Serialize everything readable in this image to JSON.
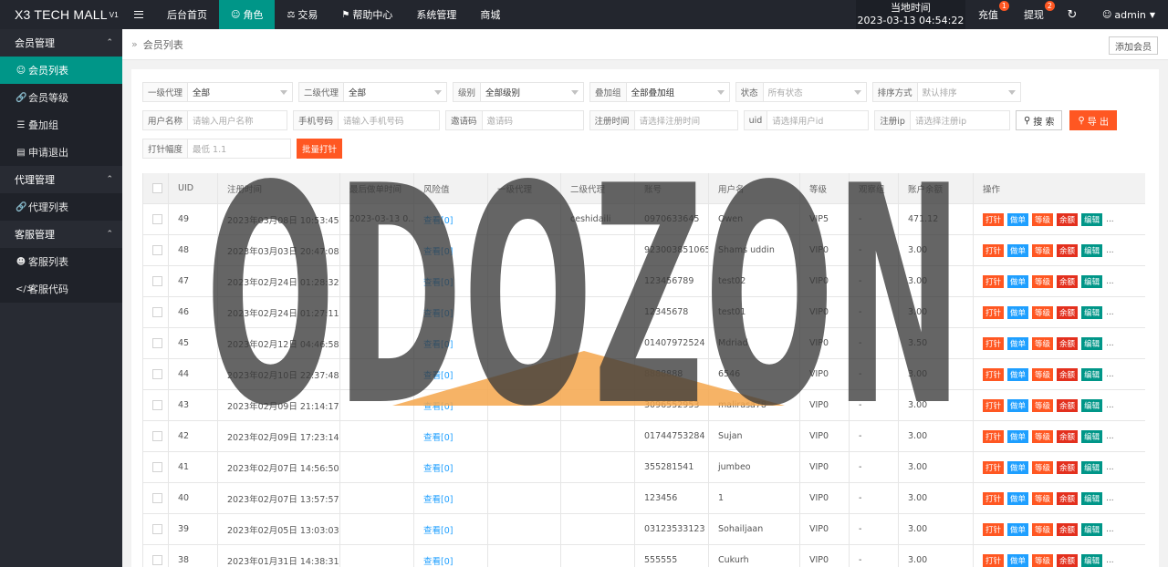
{
  "brand": {
    "name": "X3 TECH MALL",
    "version": "V1"
  },
  "topnav": {
    "items": [
      {
        "label": "后台首页",
        "icon": "",
        "active": false
      },
      {
        "label": "角色",
        "icon": "user-icon",
        "active": true
      },
      {
        "label": "交易",
        "icon": "scale-icon",
        "active": false
      },
      {
        "label": "帮助中心",
        "icon": "flag-icon",
        "active": false
      },
      {
        "label": "系统管理",
        "icon": "",
        "active": false
      },
      {
        "label": "商城",
        "icon": "",
        "active": false
      }
    ],
    "time_label": "当地时间",
    "time_value": "2023-03-13 04:54:22",
    "recharge": "充值",
    "recharge_badge": "1",
    "withdraw": "提现",
    "withdraw_badge": "2",
    "user": "admin"
  },
  "sidebar": {
    "groups": [
      {
        "label": "会员管理",
        "items": [
          {
            "label": "会员列表",
            "icon": "user-icon",
            "active": true
          },
          {
            "label": "会员等级",
            "icon": "link-icon",
            "active": false
          },
          {
            "label": "叠加组",
            "icon": "list-icon",
            "active": false
          },
          {
            "label": "申请退出",
            "icon": "doc-icon",
            "active": false
          }
        ]
      },
      {
        "label": "代理管理",
        "items": [
          {
            "label": "代理列表",
            "icon": "link-icon",
            "active": false
          }
        ]
      },
      {
        "label": "客服管理",
        "items": [
          {
            "label": "客服列表",
            "icon": "users-icon",
            "active": false
          },
          {
            "label": "客服代码",
            "icon": "code-icon",
            "active": false
          }
        ]
      }
    ]
  },
  "page": {
    "breadcrumb": "会员列表",
    "add_button": "添加会员"
  },
  "filters": {
    "agent1": {
      "label": "一级代理",
      "value": "全部"
    },
    "agent2": {
      "label": "二级代理",
      "value": "全部"
    },
    "level": {
      "label": "级别",
      "value": "全部级别"
    },
    "group": {
      "label": "叠加组",
      "value": "全部叠加组"
    },
    "status": {
      "label": "状态",
      "placeholder": "所有状态"
    },
    "sort": {
      "label": "排序方式",
      "placeholder": "默认排序"
    },
    "username": {
      "label": "用户名称",
      "placeholder": "请输入用户名称"
    },
    "phone": {
      "label": "手机号码",
      "placeholder": "请输入手机号码"
    },
    "invite": {
      "label": "邀请码",
      "placeholder": "邀请码"
    },
    "regtime": {
      "label": "注册时间",
      "placeholder": "请选择注册时间"
    },
    "uid": {
      "label": "uid",
      "placeholder": "请选择用户id"
    },
    "regip": {
      "label": "注册ip",
      "placeholder": "请选择注册ip"
    },
    "search_button": "搜 索",
    "export_button": "导 出",
    "range": {
      "label": "打针幅度",
      "placeholder": "最低 1.1"
    },
    "batch_button": "批量打针"
  },
  "table": {
    "headers": [
      "UID",
      "注册时间",
      "最后做单时间",
      "风险值",
      "一级代理",
      "二级代理",
      "账号",
      "用户名",
      "等级",
      "观察组",
      "账户余额",
      "操作"
    ],
    "actions": [
      "打针",
      "做单",
      "等级",
      "余额",
      "编辑"
    ],
    "more": "...",
    "rows": [
      {
        "uid": "49",
        "reg": "2023年03月08日 10:53:45",
        "last": "2023-03-13 0...",
        "risk": "查看[0]",
        "a1": "",
        "a2": "ceshidaili",
        "acct": "0970633645",
        "name": "Owen",
        "lvl": "VIP5",
        "grp": "-",
        "bal": "471.12"
      },
      {
        "uid": "48",
        "reg": "2023年03月03日 20:47:08",
        "last": "",
        "risk": "查看[0]",
        "a1": "",
        "a2": "",
        "acct": "923003851065",
        "name": "Shams uddin",
        "lvl": "VIP0",
        "grp": "-",
        "bal": "3.00"
      },
      {
        "uid": "47",
        "reg": "2023年02月24日 01:28:32",
        "last": "",
        "risk": "查看[0]",
        "a1": "",
        "a2": "",
        "acct": "123456789",
        "name": "test02",
        "lvl": "VIP0",
        "grp": "-",
        "bal": "3.00"
      },
      {
        "uid": "46",
        "reg": "2023年02月24日 01:27:11",
        "last": "",
        "risk": "查看[0]",
        "a1": "",
        "a2": "",
        "acct": "12345678",
        "name": "test01",
        "lvl": "VIP0",
        "grp": "-",
        "bal": "3.00"
      },
      {
        "uid": "45",
        "reg": "2023年02月12日 04:46:58",
        "last": "",
        "risk": "查看[0]",
        "a1": "",
        "a2": "",
        "acct": "01407972524",
        "name": "Mdriad",
        "lvl": "VIP0",
        "grp": "-",
        "bal": "3.50"
      },
      {
        "uid": "44",
        "reg": "2023年02月10日 22:37:48",
        "last": "",
        "risk": "查看[0]",
        "a1": "",
        "a2": "",
        "acct": "8888888",
        "name": "6546",
        "lvl": "VIP0",
        "grp": "-",
        "bal": "3.00"
      },
      {
        "uid": "43",
        "reg": "2023年02月09日 21:14:17",
        "last": "",
        "risk": "查看[0]",
        "a1": "",
        "a2": "",
        "acct": "3096552953",
        "name": "malirasa78",
        "lvl": "VIP0",
        "grp": "-",
        "bal": "3.00"
      },
      {
        "uid": "42",
        "reg": "2023年02月09日 17:23:14",
        "last": "",
        "risk": "查看[0]",
        "a1": "",
        "a2": "",
        "acct": "01744753284",
        "name": "Sujan",
        "lvl": "VIP0",
        "grp": "-",
        "bal": "3.00"
      },
      {
        "uid": "41",
        "reg": "2023年02月07日 14:56:50",
        "last": "",
        "risk": "查看[0]",
        "a1": "",
        "a2": "",
        "acct": "355281541",
        "name": "jumbeo",
        "lvl": "VIP0",
        "grp": "-",
        "bal": "3.00"
      },
      {
        "uid": "40",
        "reg": "2023年02月07日 13:57:57",
        "last": "",
        "risk": "查看[0]",
        "a1": "",
        "a2": "",
        "acct": "123456",
        "name": "1",
        "lvl": "VIP0",
        "grp": "-",
        "bal": "3.00"
      },
      {
        "uid": "39",
        "reg": "2023年02月05日 13:03:03",
        "last": "",
        "risk": "查看[0]",
        "a1": "",
        "a2": "",
        "acct": "03123533123",
        "name": "Sohailjaan",
        "lvl": "VIP0",
        "grp": "-",
        "bal": "3.00"
      },
      {
        "uid": "38",
        "reg": "2023年01月31日 14:38:31",
        "last": "",
        "risk": "查看[0]",
        "a1": "",
        "a2": "",
        "acct": "555555",
        "name": "Cukurh",
        "lvl": "VIP0",
        "grp": "-",
        "bal": "3.00"
      }
    ]
  },
  "watermark": {
    "text": "ODOZON",
    "color": "#3a3a3a",
    "accent": "#f4a64b"
  }
}
